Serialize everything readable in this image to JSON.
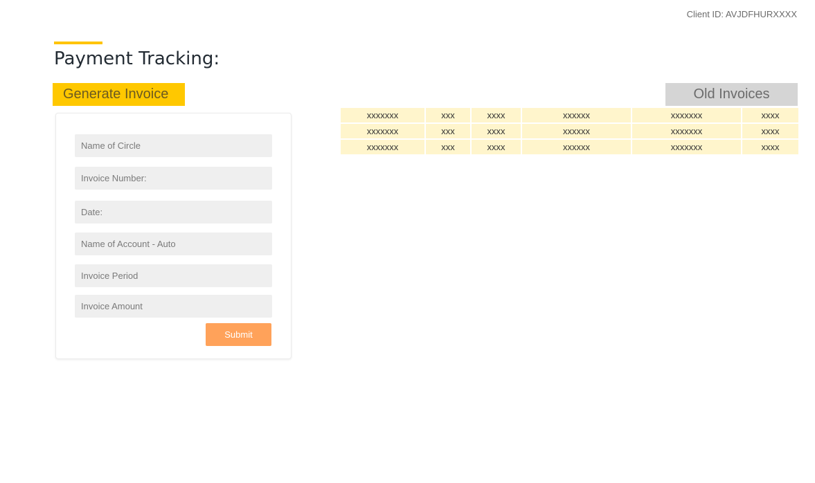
{
  "header": {
    "client_id": "Client ID: AVJDFHURXXXX",
    "title": "Payment Tracking:"
  },
  "tabs": {
    "generate": "Generate Invoice",
    "old": "Old Invoices"
  },
  "form": {
    "fields": [
      {
        "placeholder": "Name of Circle",
        "value": ""
      },
      {
        "placeholder": "Invoice Number:",
        "value": ""
      },
      {
        "placeholder": "Date:",
        "value": ""
      },
      {
        "placeholder": "Name of Account - Auto",
        "value": ""
      },
      {
        "placeholder": "Invoice Period",
        "value": ""
      },
      {
        "placeholder": "Invoice Amount",
        "value": ""
      }
    ],
    "submit_label": "Submit"
  },
  "invoices": {
    "rows": [
      [
        "xxxxxxx",
        "xxx",
        "xxxx",
        "xxxxxx",
        "xxxxxxx",
        "xxxx"
      ],
      [
        "xxxxxxx",
        "xxx",
        "xxxx",
        "xxxxxx",
        "xxxxxxx",
        "xxxx"
      ],
      [
        "xxxxxxx",
        "xxx",
        "xxxx",
        "xxxxxx",
        "xxxxxxx",
        "xxxx"
      ]
    ]
  },
  "colors": {
    "accent": "#ffc800",
    "submit": "#ffa25a",
    "table_cell": "#fff5cc",
    "old_tab": "#d5d5d5"
  }
}
